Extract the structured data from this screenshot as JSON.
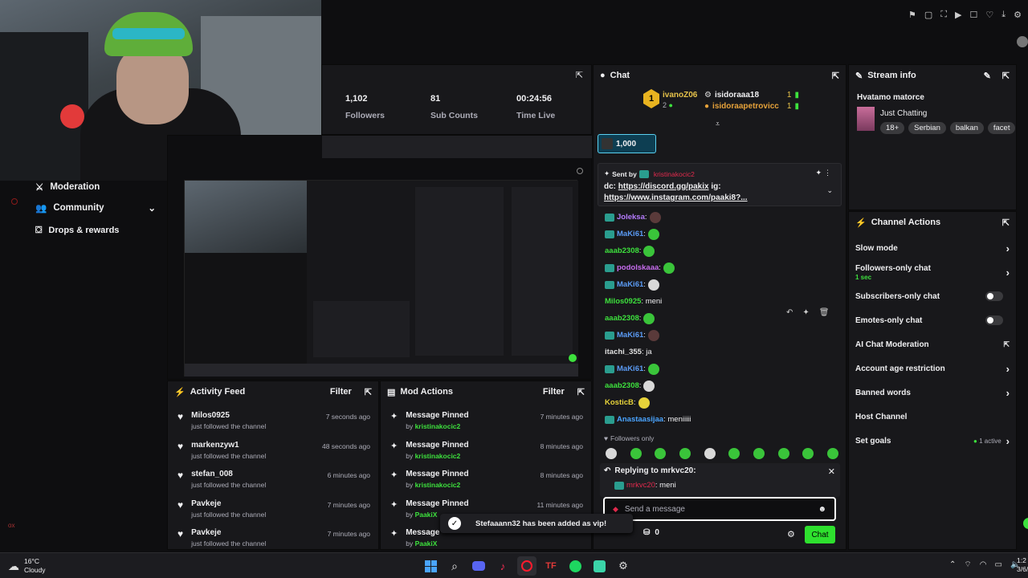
{
  "stats": [
    {
      "value": "1,102",
      "label": "Followers"
    },
    {
      "value": "81",
      "label": "Sub Counts"
    },
    {
      "value": "00:24:56",
      "label": "Time Live"
    }
  ],
  "sidebar": {
    "items": [
      {
        "label": "Moderation"
      },
      {
        "label": "Community"
      },
      {
        "label": "Drops & rewards"
      }
    ]
  },
  "chat": {
    "title": "Chat",
    "leaders": [
      {
        "rank": "1",
        "name": "ivanoZ06",
        "sub": "2"
      },
      {
        "name": "isidoraaa18",
        "count": "1"
      },
      {
        "name": "isidoraapetrovicc",
        "count": "1"
      }
    ],
    "hype_value": "1,000",
    "pinned": {
      "sent_by": "Sent by",
      "author": "kristinakocic2",
      "line1_prefix": "dc: ",
      "link1": "https://discord.gg/pakix",
      "line1_suffix": " ig:",
      "link2": "https://www.instagram.com/paaki8?..."
    },
    "messages": [
      {
        "user": "Joleksa",
        "color": "#b67cff",
        "text": ":",
        "emote": "dk"
      },
      {
        "user": "MaKi61",
        "color": "#5b9cf6",
        "text": ":",
        "emote": "g"
      },
      {
        "user": "aaab2308",
        "color": "#3de13d",
        "text": ":",
        "emote": "g"
      },
      {
        "user": "podolskaaa",
        "color": "#c86df0",
        "text": ":",
        "emote": "g"
      },
      {
        "user": "MaKi61",
        "color": "#5b9cf6",
        "text": ":",
        "emote": "wh"
      },
      {
        "user": "Milos0925",
        "color": "#3de13d",
        "text": ": meni",
        "emote": ""
      },
      {
        "user": "aaab2308",
        "color": "#3de13d",
        "text": ":",
        "emote": "g"
      },
      {
        "user": "MaKi61",
        "color": "#5b9cf6",
        "text": ":",
        "emote": "dk"
      },
      {
        "user": "itachi_355",
        "color": "#e0e0e0",
        "text": ": ja",
        "emote": ""
      },
      {
        "user": "MaKi61",
        "color": "#5b9cf6",
        "text": ":",
        "emote": "g"
      },
      {
        "user": "aaab2308",
        "color": "#3de13d",
        "text": ":",
        "emote": "wh"
      },
      {
        "user": "KosticB",
        "color": "#e6d23a",
        "text": ":",
        "emote": "yl"
      },
      {
        "user": "Anastaasijaa",
        "color": "#4aa4ff",
        "text": ": meniiiii",
        "emote": ""
      }
    ],
    "followers_only": "Followers only",
    "reply": {
      "label": "Replying to mrkvc20:",
      "user": "mrkvc20",
      "text": ": meni"
    },
    "input_placeholder": "Send a message",
    "points": "0",
    "send_label": "Chat"
  },
  "stream_info": {
    "title": "Stream info",
    "stream_title": "Hvatamo matorce",
    "category": "Just Chatting",
    "tags": [
      "18+",
      "Serbian",
      "balkan",
      "facet"
    ]
  },
  "channel_actions": {
    "title": "Channel Actions",
    "items": [
      {
        "label": "Slow mode",
        "sub": "",
        "control": "chevron"
      },
      {
        "label": "Followers-only chat",
        "sub": "1 sec",
        "control": "chevron"
      },
      {
        "label": "Subscribers-only chat",
        "sub": "",
        "control": "toggle"
      },
      {
        "label": "Emotes-only chat",
        "sub": "",
        "control": "toggle"
      },
      {
        "label": "AI Chat Moderation",
        "sub": "",
        "control": "external"
      },
      {
        "label": "Account age restriction",
        "sub": "",
        "control": "chevron"
      },
      {
        "label": "Banned words",
        "sub": "",
        "control": "chevron"
      },
      {
        "label": "Host Channel",
        "sub": "",
        "control": "none"
      },
      {
        "label": "Set goals",
        "sub": "",
        "control": "chevron",
        "badge": "1 active"
      }
    ]
  },
  "activity_feed": {
    "title": "Activity Feed",
    "filter": "Filter",
    "items": [
      {
        "name": "Milos0925",
        "sub": "just followed the channel",
        "time": "7 seconds ago"
      },
      {
        "name": "markenzyw1",
        "sub": "just followed the channel",
        "time": "48 seconds ago"
      },
      {
        "name": "stefan_008",
        "sub": "just followed the channel",
        "time": "6 minutes ago"
      },
      {
        "name": "Pavkeje",
        "sub": "just followed the channel",
        "time": "7 minutes ago"
      },
      {
        "name": "Pavkeje",
        "sub": "just followed the channel",
        "time": "7 minutes ago"
      }
    ]
  },
  "mod_actions": {
    "title": "Mod Actions",
    "filter": "Filter",
    "items": [
      {
        "name": "Message Pinned",
        "by": "by ",
        "mod": "kristinakocic2",
        "time": "7 minutes ago"
      },
      {
        "name": "Message Pinned",
        "by": "by ",
        "mod": "kristinakocic2",
        "time": "8 minutes ago"
      },
      {
        "name": "Message Pinned",
        "by": "by ",
        "mod": "kristinakocic2",
        "time": "8 minutes ago"
      },
      {
        "name": "Message Pinned",
        "by": "by ",
        "mod": "PaakiX",
        "time": "11 minutes ago"
      },
      {
        "name": "Message",
        "by": "by ",
        "mod": "PaakiX",
        "time": ""
      }
    ]
  },
  "toast": {
    "text": "Stefaaann32 has been added as vip!"
  },
  "taskbar": {
    "temp": "16°C",
    "weather": "Cloudy",
    "time": "1:2",
    "date": "3/6/"
  },
  "colors": {
    "accent": "#3de13d",
    "panel": "#18181b",
    "bg": "#0e0e10"
  }
}
